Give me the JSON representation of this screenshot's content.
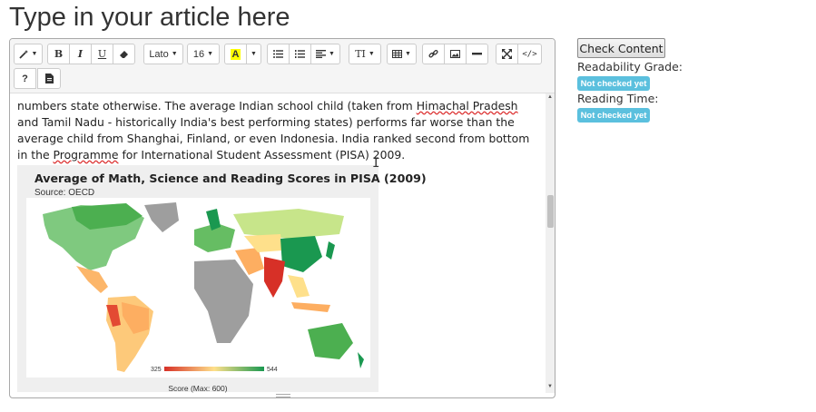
{
  "page": {
    "title": "Type in your article here"
  },
  "toolbar": {
    "style_icon": "magic-wand-icon",
    "bold": "B",
    "italic": "I",
    "underline": "U",
    "eraser_icon": "eraser-icon",
    "font_family": "Lato",
    "font_size": "16",
    "highlight": "A",
    "highlight_color": "#ffff00",
    "ul_icon": "unordered-list-icon",
    "ol_icon": "ordered-list-icon",
    "align_icon": "align-icon",
    "height_icon": "line-height-icon",
    "height_text": "TI",
    "table_icon": "table-icon",
    "link_icon": "link-icon",
    "image_icon": "image-icon",
    "hr_icon": "horizontal-rule-icon",
    "fullscreen_icon": "fullscreen-icon",
    "code_text": "</>",
    "help": "?",
    "doc_icon": "document-icon"
  },
  "article": {
    "text_1": "numbers state otherwise. The average Indian school child (taken from ",
    "spell_1": "Himachal Pradesh",
    "text_2": " and Tamil Nadu - historically India's best performing states)  performs far worse than the average child from Shanghai, Finland, or even Indonesia. India ranked second from bottom in the ",
    "spell_2": "Programme",
    "text_3": " for International Student Assessment (PISA) 2009."
  },
  "figure": {
    "title": "Average of Math, Science and Reading Scores in PISA (2009)",
    "source": "Source: OECD",
    "legend_min": "325",
    "legend_max": "544",
    "legend_label": "Score (Max: 600)",
    "colors": {
      "low": "#d73027",
      "mid": "#fee08b",
      "high": "#1a9850",
      "nodata": "#9e9e9e"
    }
  },
  "sidebar": {
    "check_button": "Check Content",
    "readability_label": "Readability Grade:",
    "readability_value": "Not checked yet",
    "reading_time_label": "Reading Time:",
    "reading_time_value": "Not checked yet",
    "badge_color": "#5bc0de"
  }
}
